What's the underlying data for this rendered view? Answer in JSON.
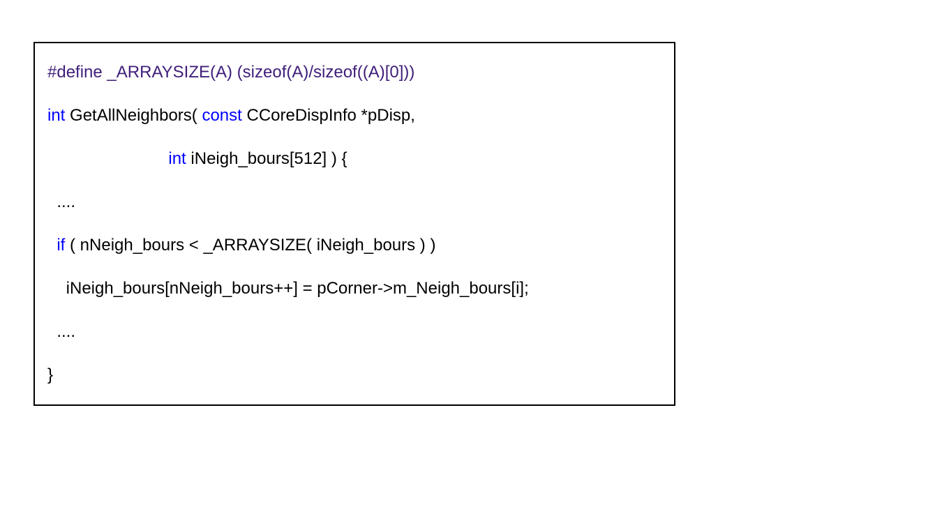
{
  "code": {
    "line1_pre": "#define",
    "line1_rest": " _ARRAYSIZE(A) (sizeof(A)/sizeof((A)[0]))",
    "line2_kw": "int",
    "line2_mid": " GetAllNeighbors( ",
    "line2_kw2": "const",
    "line2_rest": " CCoreDispInfo *pDisp,",
    "line3_indent": "                          ",
    "line3_kw": "int",
    "line3_rest": " iNeigh_bours[512] ) {",
    "line4": "  ....",
    "line5_indent": "  ",
    "line5_kw": "if",
    "line5_rest": " ( nNeigh_bours < _ARRAYSIZE( iNeigh_bours ) )",
    "line6": "    iNeigh_bours[nNeigh_bours++] = pCorner->m_Neigh_bours[i];",
    "line7": "  ....",
    "line8": "}"
  }
}
